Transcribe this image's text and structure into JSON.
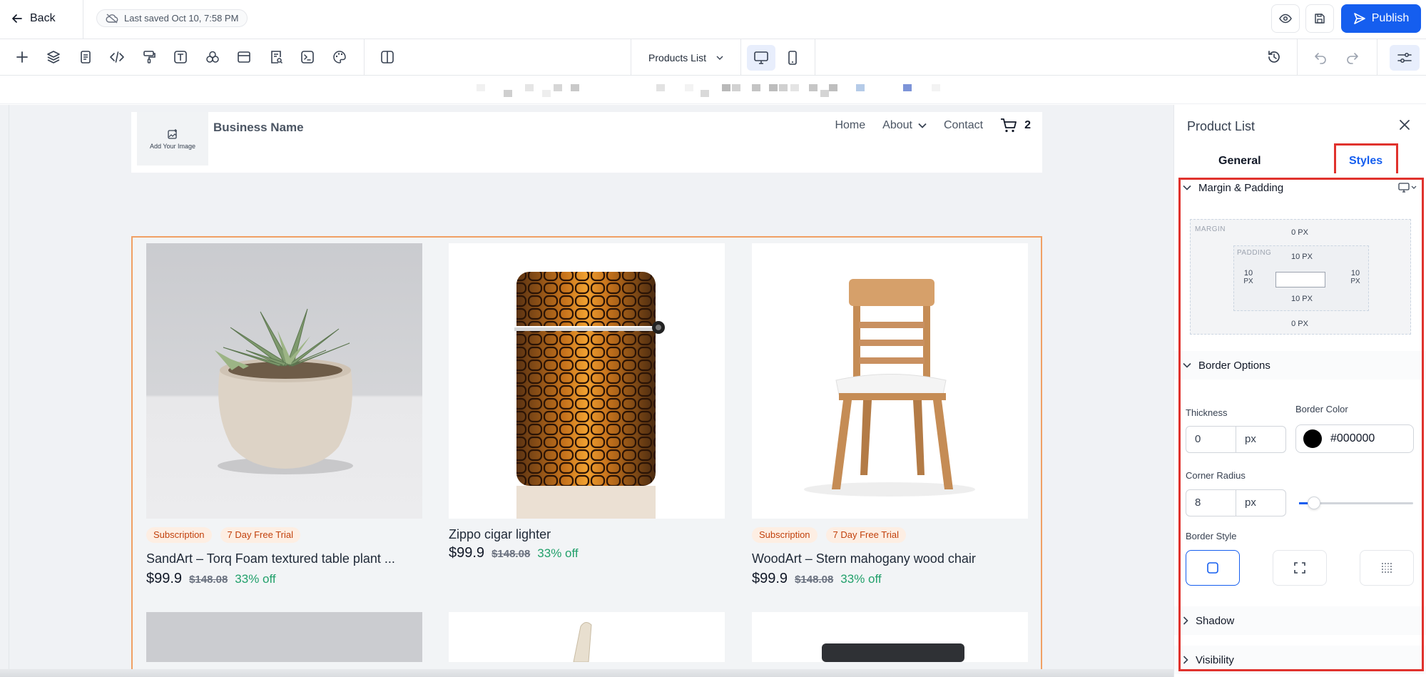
{
  "topbar": {
    "back_label": "Back",
    "saved_text": "Last saved Oct 10, 7:58 PM",
    "publish_label": "Publish",
    "icons": [
      "arrow-left-icon",
      "cloud-off-icon",
      "eye-icon",
      "save-icon",
      "send-icon"
    ]
  },
  "toolbar": {
    "page_select": "Products List",
    "tools": [
      "plus-icon",
      "layers-icon",
      "pages-icon",
      "code-icon",
      "paint-roller-icon",
      "text-icon",
      "shapes-icon",
      "section-icon",
      "form-search-icon",
      "terminal-icon",
      "palette-icon",
      "split-view-icon"
    ],
    "device_active": "desktop"
  },
  "site": {
    "logo_text": "Add Your Image",
    "business_name": "Business Name",
    "nav": [
      {
        "label": "Home"
      },
      {
        "label": "About"
      },
      {
        "label": "Contact"
      }
    ],
    "cart_count": "2"
  },
  "products": [
    {
      "name": "SandArt – Torq Foam textured table plant ...",
      "price": "$99.9",
      "old_price": "$148.08",
      "discount": "33% off",
      "badges": [
        "Subscription",
        "7 Day Free Trial"
      ],
      "image": "succulent-pot"
    },
    {
      "name": "Zippo cigar lighter",
      "price": "$99.9",
      "old_price": "$148.08",
      "discount": "33% off",
      "badges": [],
      "image": "lighter"
    },
    {
      "name": "WoodArt – Stern mahogany wood chair",
      "price": "$99.9",
      "old_price": "$148.08",
      "discount": "33% off",
      "badges": [
        "Subscription",
        "7 Day Free Trial"
      ],
      "image": "wooden-chair"
    }
  ],
  "panel": {
    "title": "Product List",
    "tabs": {
      "general": "General",
      "styles": "Styles"
    },
    "active_tab": "Styles",
    "margin_padding": {
      "heading": "Margin & Padding",
      "margin_label": "MARGIN",
      "padding_label": "PADDING",
      "margin_top": "0 PX",
      "margin_bottom": "0 PX",
      "padding_top": "10 PX",
      "padding_bottom": "10 PX",
      "padding_left": "10",
      "padding_left_unit": "PX",
      "padding_right": "10",
      "padding_right_unit": "PX"
    },
    "border": {
      "heading": "Border Options",
      "thickness_label": "Thickness",
      "thickness_value": "0",
      "thickness_unit": "px",
      "color_label": "Border Color",
      "color_value": "#000000",
      "radius_label": "Corner Radius",
      "radius_value": "8",
      "radius_unit": "px",
      "radius_slider_fraction": 0.13,
      "style_label": "Border Style",
      "styles": [
        "solid-square-icon",
        "dashed-corners-icon",
        "dotted-square-icon"
      ],
      "active_style": 0
    },
    "shadow_heading": "Shadow",
    "visibility_heading": "Visibility"
  },
  "colors": {
    "accent": "#155eef",
    "highlight": "#e0322d",
    "selection": "#f0a064",
    "discount": "#22a06b"
  }
}
